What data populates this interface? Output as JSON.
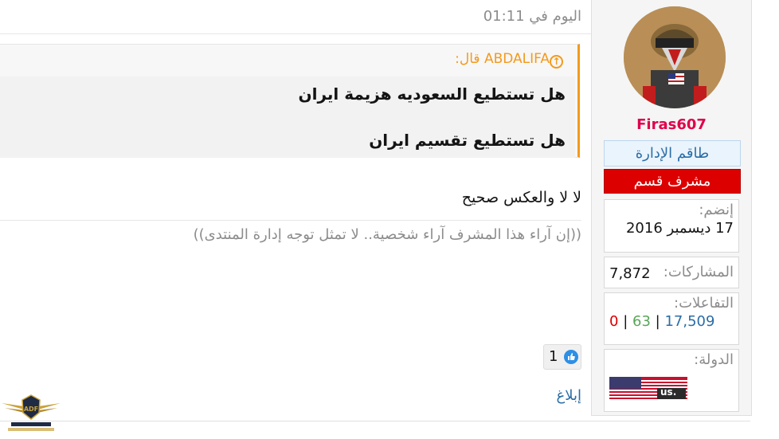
{
  "post": {
    "date": "اليوم في 01:11",
    "quote": {
      "author_line": "ABDALIFA قال:",
      "lines": [
        "هل تستطيع السعوديه هزيمة ايران",
        "هل تستطيع تقسيم ايران"
      ]
    },
    "reply": "لا لا والعكس صحيح",
    "signature": "((إن آراء هذا المشرف آراء شخصية.. لا تمثل توجه إدارة المنتدى))",
    "like_count": "1",
    "report": "إبلاغ"
  },
  "user": {
    "name": "Firas607",
    "staff_badge": "طاقم الإدارة",
    "mod_badge": "مشرف قسم",
    "joined_label": "إنضم:",
    "joined_value": "17 ديسمبر 2016",
    "posts_label": "المشاركات:",
    "posts_value": "7,872",
    "reactions_label": "التفاعلات:",
    "reactions": {
      "a": "17,509",
      "sep1": "|",
      "b": "63",
      "sep2": "|",
      "c": "0"
    },
    "country_label": "الدولة:",
    "flag_code": ".us"
  },
  "logo": {
    "line1": "ARAB DEFENSE FORUM",
    "line2": "المنتدى العربي للدفاع والتسليح"
  },
  "colors": {
    "username": "#e0004a",
    "quote_accent": "#f39a1d",
    "link": "#2b6da6",
    "mod_badge": "#dd0000",
    "reaction_blue": "#2b6da6",
    "reaction_green": "#5aa55a",
    "reaction_red": "#dd0000"
  },
  "icons": {
    "quote": "arrow-up-circle-icon",
    "like": "thumbs-up-icon"
  }
}
